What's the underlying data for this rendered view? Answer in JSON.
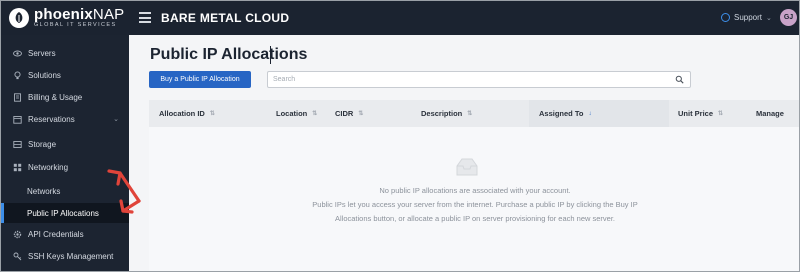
{
  "brand": {
    "name_bold": "phoenix",
    "name_rest": "NAP",
    "tagline": "GLOBAL IT SERVICES"
  },
  "header": {
    "app_title": "BARE METAL CLOUD",
    "support_label": "Support",
    "avatar_initials": "GJ"
  },
  "sidebar": {
    "items": [
      {
        "label": "Servers",
        "icon": "eye-icon"
      },
      {
        "label": "Solutions",
        "icon": "lightbulb-icon"
      },
      {
        "label": "Billing & Usage",
        "icon": "receipt-icon"
      },
      {
        "label": "Reservations",
        "icon": "calendar-icon",
        "expandable": true
      },
      {
        "label": "Storage",
        "icon": "storage-icon"
      },
      {
        "label": "Networking",
        "icon": "network-icon"
      }
    ],
    "subitems": [
      {
        "label": "Networks"
      },
      {
        "label": "Public IP Allocations",
        "active": true
      }
    ],
    "items_after": [
      {
        "label": "API Credentials",
        "icon": "gear-icon"
      },
      {
        "label": "SSH Keys Management",
        "icon": "key-icon"
      }
    ]
  },
  "main": {
    "title": "Public IP Allocations",
    "buy_button": "Buy a Public IP Allocation",
    "search_placeholder": "Search",
    "columns": [
      {
        "label": "Allocation ID",
        "sortable": true
      },
      {
        "label": "Location",
        "sortable": true
      },
      {
        "label": "CIDR",
        "sortable": true
      },
      {
        "label": "Description",
        "sortable": true
      },
      {
        "label": "Assigned To",
        "sortable": true,
        "sorted": "desc"
      },
      {
        "label": "Unit Price",
        "sortable": true
      },
      {
        "label": "Manage",
        "sortable": false
      }
    ],
    "empty_state": {
      "line1": "No public IP allocations are associated with your account.",
      "line2": "Public IPs let you access your server from the internet. Purchase a public IP by clicking the Buy IP",
      "line3": "Allocations button, or allocate a public IP on server provisioning for each new server."
    }
  },
  "colors": {
    "topbar": "#1b2330",
    "sidebar": "#1c2431",
    "primary": "#2765c4",
    "annotation_arrow": "#e0443a"
  }
}
